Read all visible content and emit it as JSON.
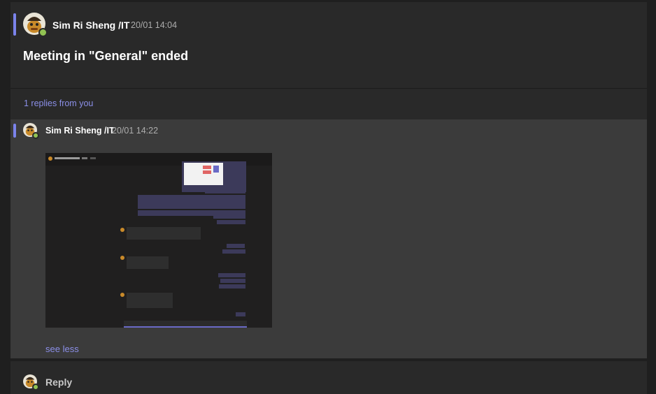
{
  "post": {
    "author": "Sim Ri Sheng /IT",
    "time": "20/01 14:04",
    "title": "Meeting in \"General\" ended"
  },
  "thread": {
    "replies_text": "1 replies from you"
  },
  "reply": {
    "author": "Sim Ri Sheng /IT",
    "time": "20/01 14:22",
    "attachment_icon": "screenshot-image",
    "see_less": "see less"
  },
  "composer": {
    "reply_label": "Reply"
  },
  "colors": {
    "accent": "#7b83eb",
    "link": "#8b8fe8",
    "presence": "#92c353",
    "background": "#1f1f1f",
    "card": "#292929",
    "reply_background": "#3b3b3b"
  }
}
